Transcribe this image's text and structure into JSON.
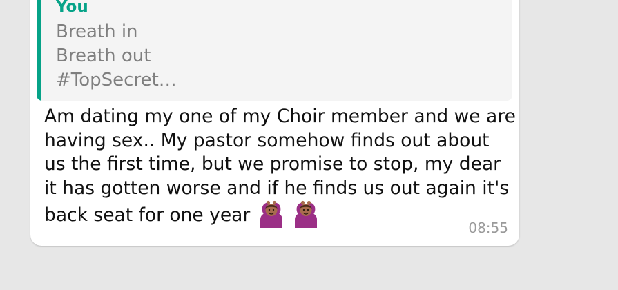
{
  "quoted_message": {
    "author": "You",
    "lines": [
      "Breath in",
      "Breath out",
      "#TopSecret…"
    ]
  },
  "message": {
    "lines": [
      "Am dating my one of my Choir member and we are",
      "having sex.. My pastor somehow finds out about",
      "us the first time, but we promise to stop, my dear",
      "it has gotten worse and if he finds us out again it's",
      "back seat for one year"
    ],
    "emojis": [
      "person-gesturing-ok-icon",
      "person-gesturing-ok-icon"
    ],
    "time": "08:55"
  },
  "colors": {
    "background": "#e7e7e7",
    "bubble": "#ffffff",
    "quote_background": "#f4f4f4",
    "quote_accent": "#06a388",
    "quote_text": "#7f7f7f",
    "message_text": "#111111",
    "timestamp": "#9a9a9a"
  }
}
